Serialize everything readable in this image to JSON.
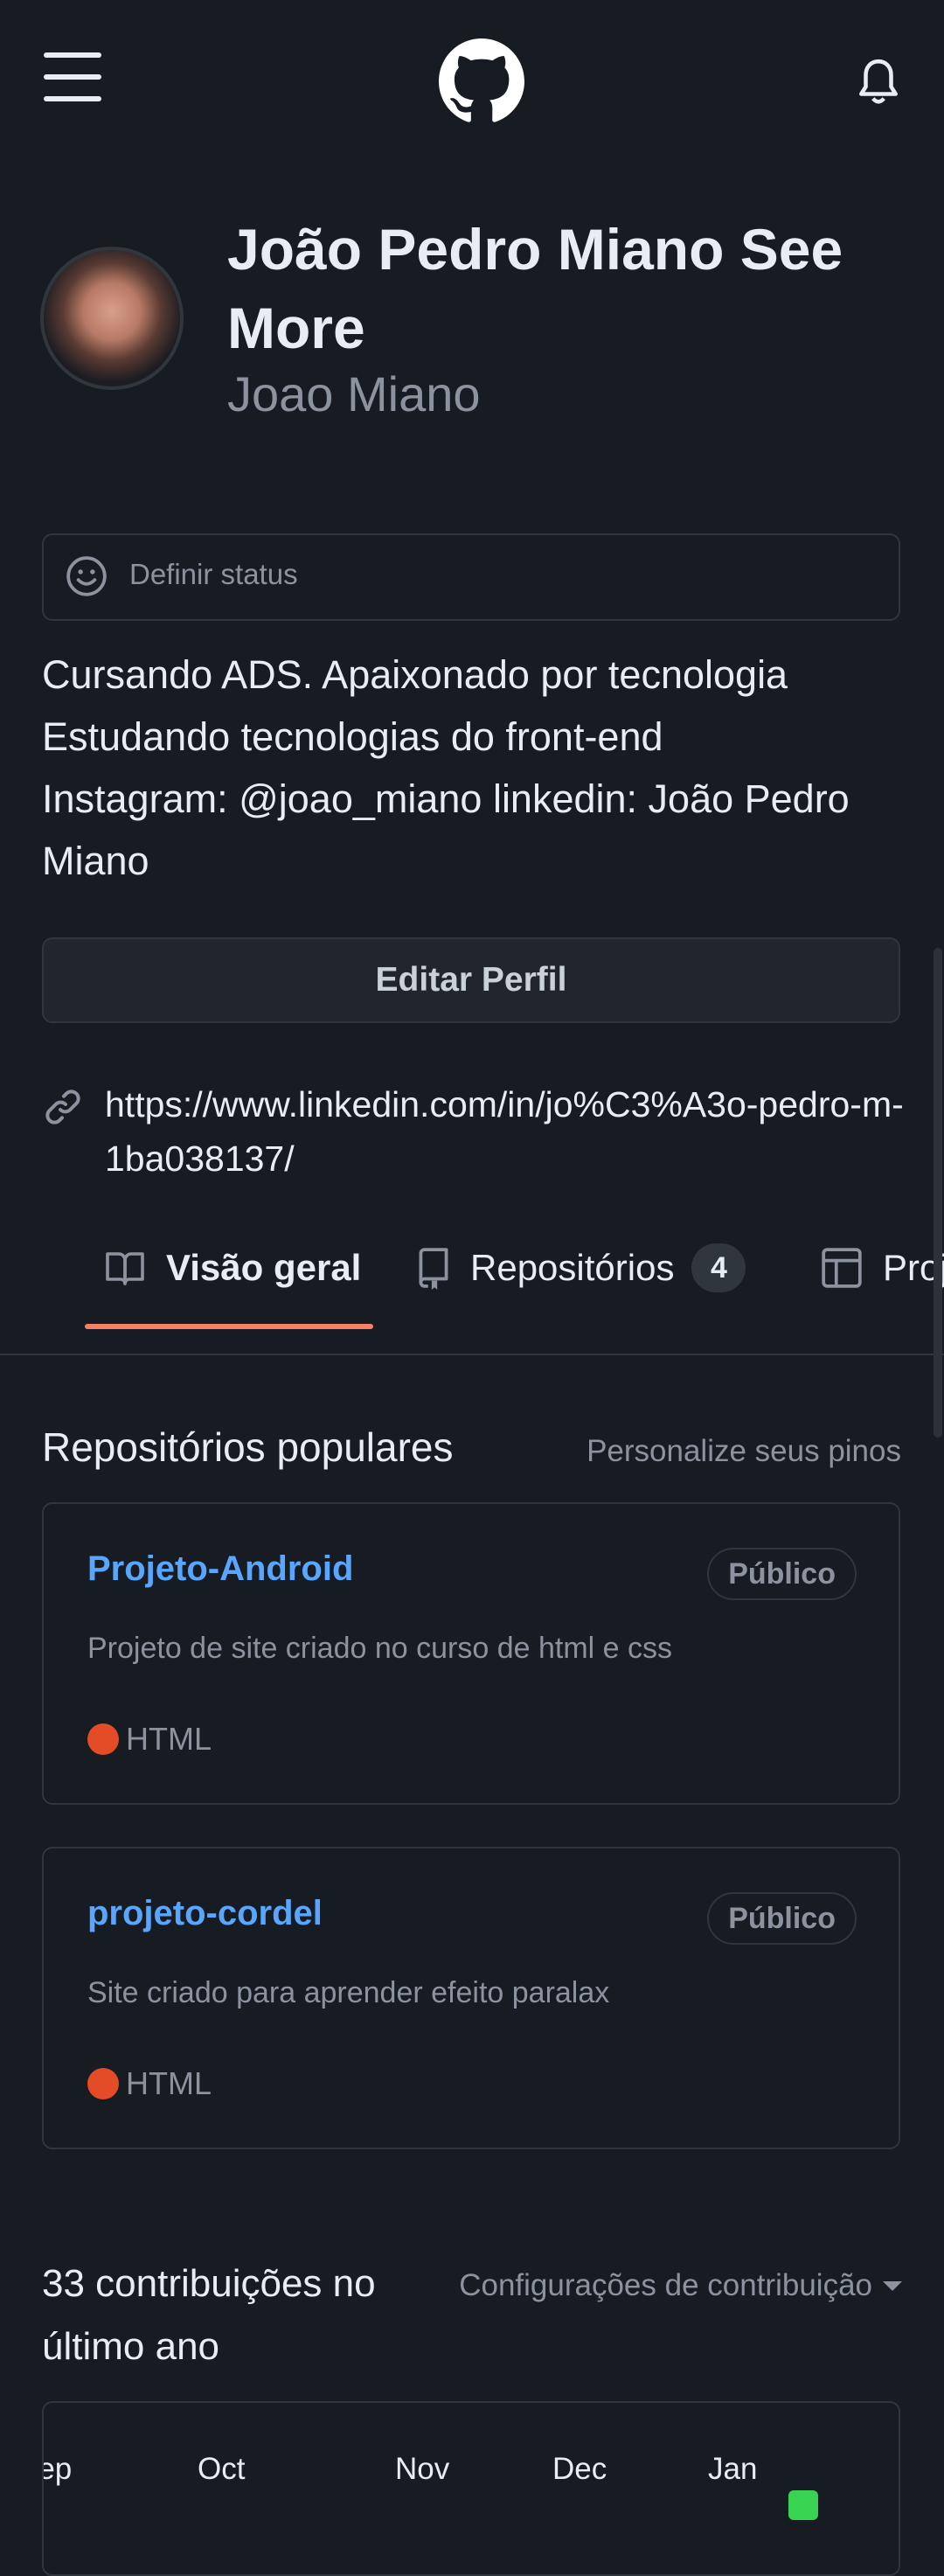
{
  "header": {
    "menu_icon": "hamburger-menu-icon",
    "logo_icon": "github-octocat-logo",
    "notifications_icon": "bell-icon"
  },
  "profile": {
    "display_name": "João Pedro Miano See More",
    "username": "Joao Miano",
    "status_placeholder": "Definir status",
    "bio": [
      "Cursando ADS. Apaixonado por tecnologia",
      "Estudando tecnologias do front-end",
      "Instagram: @joao_miano linkedin: João Pedro",
      "Miano"
    ],
    "edit_button": "Editar Perfil",
    "website": "https://www.linkedin.com/in/jo%C3%A3o-pedro-m-1ba038137/"
  },
  "tabs": [
    {
      "label": "Visão geral",
      "icon": "book-icon",
      "active": true
    },
    {
      "label": "Repositórios",
      "icon": "repo-icon",
      "count": "4"
    },
    {
      "label": "Projetos",
      "icon": "table-icon"
    }
  ],
  "popular": {
    "title": "Repositórios populares",
    "customize_link": "Personalize seus pinos",
    "repos": [
      {
        "name": "Projeto-Android",
        "visibility": "Público",
        "description": "Projeto de site criado no curso de html e css",
        "language": "HTML",
        "language_color": "#e34c26"
      },
      {
        "name": "projeto-cordel",
        "visibility": "Público",
        "description": "Site criado para aprender efeito paralax",
        "language": "HTML",
        "language_color": "#e34c26"
      }
    ]
  },
  "contributions": {
    "title": "33 contribuições no último ano",
    "settings_label": "Configurações de contribuição",
    "months": [
      "Sep",
      "Oct",
      "Nov",
      "Dec",
      "Jan"
    ],
    "cell_color": "#39d353"
  },
  "colors": {
    "background": "#171b22",
    "accent_tab": "#f78166",
    "link_blue": "#58a6ff"
  }
}
